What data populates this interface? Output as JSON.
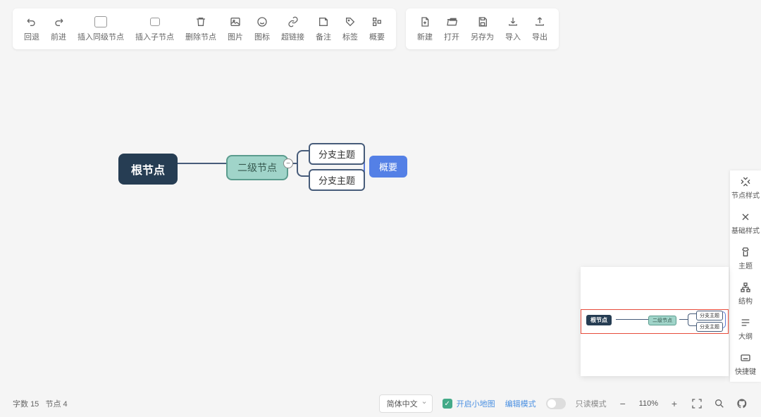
{
  "toolbar": {
    "edit": [
      {
        "label": "回退",
        "icon": "undo"
      },
      {
        "label": "前进",
        "icon": "redo"
      },
      {
        "label": "插入同级节点",
        "icon": "sibling"
      },
      {
        "label": "插入子节点",
        "icon": "child"
      },
      {
        "label": "删除节点",
        "icon": "delete"
      },
      {
        "label": "图片",
        "icon": "image"
      },
      {
        "label": "图标",
        "icon": "emoji"
      },
      {
        "label": "超链接",
        "icon": "link"
      },
      {
        "label": "备注",
        "icon": "note"
      },
      {
        "label": "标签",
        "icon": "tag"
      },
      {
        "label": "概要",
        "icon": "summary"
      }
    ],
    "file": [
      {
        "label": "新建",
        "icon": "new"
      },
      {
        "label": "打开",
        "icon": "open"
      },
      {
        "label": "另存为",
        "icon": "saveas"
      },
      {
        "label": "导入",
        "icon": "import"
      },
      {
        "label": "导出",
        "icon": "export"
      }
    ]
  },
  "mindmap": {
    "root": "根节点",
    "level2": "二级节点",
    "branch1": "分支主题",
    "branch2": "分支主题",
    "summary": "概要"
  },
  "minimap": {
    "root": "根节点",
    "level2": "二级节点",
    "branch1": "分支主题",
    "branch2": "分支主题"
  },
  "sidepanel": [
    {
      "label": "节点样式",
      "icon": "node-style"
    },
    {
      "label": "基础样式",
      "icon": "base-style"
    },
    {
      "label": "主题",
      "icon": "theme"
    },
    {
      "label": "结构",
      "icon": "structure"
    },
    {
      "label": "大纲",
      "icon": "outline"
    },
    {
      "label": "快捷键",
      "icon": "shortcut"
    }
  ],
  "status": {
    "word_label": "字数",
    "word_count": "15",
    "node_label": "节点",
    "node_count": "4",
    "language": "简体中文",
    "minimap_check": "开启小地图",
    "edit_mode": "编辑模式",
    "readonly_mode": "只读模式",
    "zoom": "110%"
  }
}
